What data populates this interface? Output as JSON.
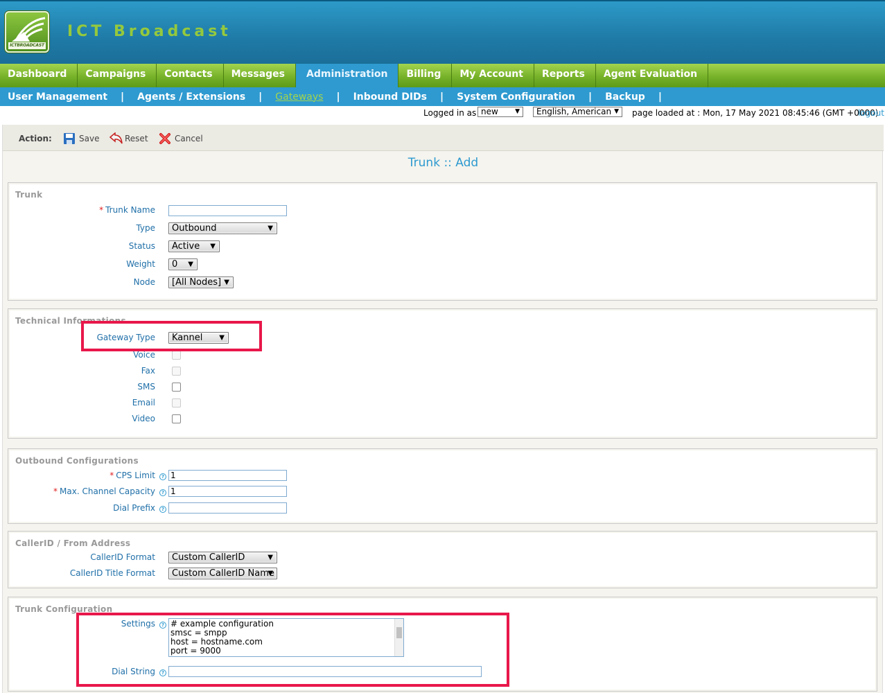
{
  "app": {
    "brand": "ICT Broadcast",
    "logo_text": "ICTBROADCAST"
  },
  "main_nav": [
    {
      "label": "Dashboard"
    },
    {
      "label": "Campaigns"
    },
    {
      "label": "Contacts"
    },
    {
      "label": "Messages"
    },
    {
      "label": "Administration",
      "active": true
    },
    {
      "label": "Billing"
    },
    {
      "label": "My Account"
    },
    {
      "label": "Reports"
    },
    {
      "label": "Agent Evaluation"
    }
  ],
  "sub_nav": [
    {
      "label": "User Management"
    },
    {
      "label": "Agents / Extensions"
    },
    {
      "label": "Gateways",
      "active": true
    },
    {
      "label": "Inbound DIDs"
    },
    {
      "label": "System Configuration"
    },
    {
      "label": "Backup"
    }
  ],
  "sub_nav_separator": "|",
  "status": {
    "logged_in_label": "Logged in as :",
    "user": "new",
    "language": "English, American",
    "page_loaded": "page loaded at : Mon, 17 May 2021 08:45:46 (GMT +0000)",
    "logout": "logout"
  },
  "actions": {
    "label": "Action:",
    "save": "Save",
    "reset": "Reset",
    "cancel": "Cancel"
  },
  "page_title": "Trunk :: Add",
  "trunk": {
    "legend": "Trunk",
    "name_label": "Trunk Name",
    "name_value": "",
    "type_label": "Type",
    "type_value": "Outbound",
    "status_label": "Status",
    "status_value": "Active",
    "weight_label": "Weight",
    "weight_value": "0",
    "node_label": "Node",
    "node_value": "[All Nodes]"
  },
  "technical": {
    "legend": "Technical Informations",
    "gateway_type_label": "Gateway Type",
    "gateway_type_value": "Kannel",
    "voice_label": "Voice",
    "fax_label": "Fax",
    "sms_label": "SMS",
    "email_label": "Email",
    "video_label": "Video"
  },
  "outbound": {
    "legend": "Outbound Configurations",
    "cps_label": "CPS Limit",
    "cps_value": "1",
    "channel_label": "Max. Channel Capacity",
    "channel_value": "1",
    "prefix_label": "Dial Prefix",
    "prefix_value": ""
  },
  "callerid": {
    "legend": "CallerID / From Address",
    "format_label": "CallerID Format",
    "format_value": "Custom CallerID",
    "title_label": "CallerID Title Format",
    "title_value": "Custom CallerID Name"
  },
  "trunk_config": {
    "legend": "Trunk Configuration",
    "settings_label": "Settings",
    "settings_value": "# example configuration\nsmsc = smpp\nhost = hostname.com\nport = 9000",
    "dial_string_label": "Dial String",
    "dial_string_value": ""
  },
  "required_mark": "*",
  "help_mark": "?",
  "arrow_glyph": "▼",
  "colors": {
    "header_blue": "#1f7aa6",
    "nav_green": "#77b22a",
    "subnav_blue": "#2e9ad0",
    "highlight": "#e8174a",
    "brand_green": "#95c93d"
  }
}
